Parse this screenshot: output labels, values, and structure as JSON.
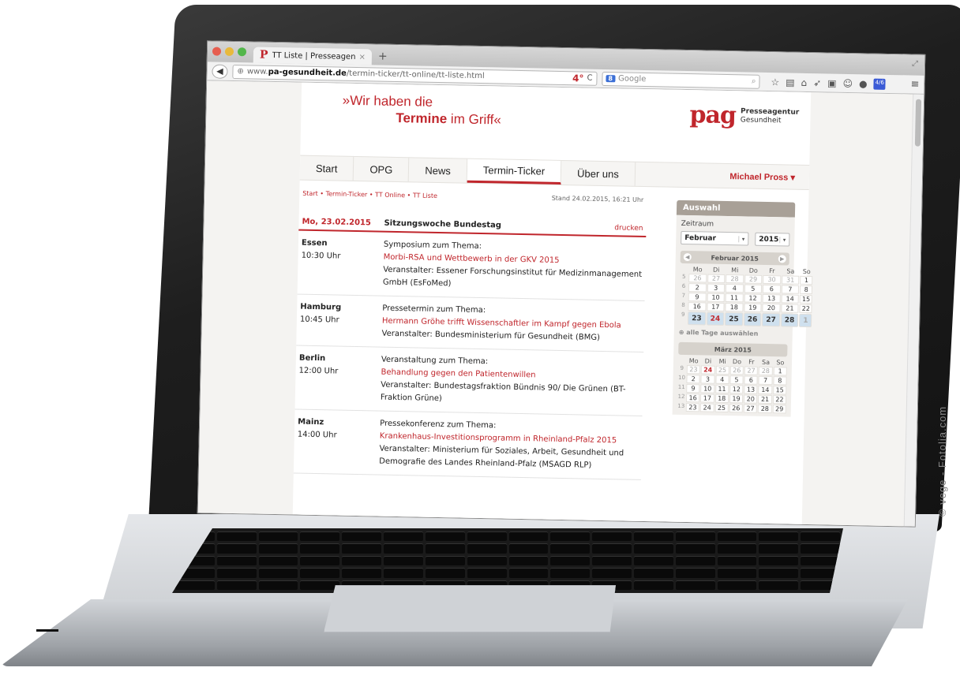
{
  "browser": {
    "tab_title": "TT Liste | Presseagentur G...",
    "tab_close": "×",
    "new_tab": "+",
    "url_prefix": "www.",
    "url_host": "pa-gesundheit.de",
    "url_path": "/termin-ticker/tt-online/tt-liste.html",
    "url_badge": "4°",
    "reload": "C",
    "search_engine": "8",
    "search_placeholder": "Google"
  },
  "header": {
    "slogan_line1": "»Wir haben die",
    "slogan_bold": "Termine",
    "slogan_line2_rest": " im Griff«",
    "logo_mark": "pag",
    "logo_line1": "Presseagentur",
    "logo_line2": "Gesundheit"
  },
  "nav": {
    "items": [
      "Start",
      "OPG",
      "News",
      "Termin-Ticker",
      "Über uns"
    ],
    "active_index": 3,
    "user": "Michael Pross ▾"
  },
  "content": {
    "breadcrumb": "Start • Termin-Ticker • TT Online • TT Liste",
    "stand": "Stand 24.02.2015, 16:21 Uhr",
    "day_date": "Mo, 23.02.2015",
    "day_session": "Sitzungswoche Bundestag",
    "print_label": "drucken",
    "events": [
      {
        "city": "Essen",
        "time": "10:30 Uhr",
        "kind": "Symposium zum Thema:",
        "title": "Morbi-RSA und Wettbewerb in der GKV 2015",
        "organizer": "Veranstalter: Essener Forschungsinstitut für Medizinmanagement GmbH (EsFoMed)"
      },
      {
        "city": "Hamburg",
        "time": "10:45 Uhr",
        "kind": "Pressetermin zum Thema:",
        "title": "Hermann Gröhe trifft Wissenschaftler im Kampf gegen Ebola",
        "organizer": "Veranstalter: Bundesministerium für Gesundheit (BMG)"
      },
      {
        "city": "Berlin",
        "time": "12:00 Uhr",
        "kind": "Veranstaltung zum Thema:",
        "title": "Behandlung gegen den Patientenwillen",
        "organizer": "Veranstalter: Bundestagsfraktion Bündnis 90/ Die Grünen (BT-Fraktion Grüne)"
      },
      {
        "city": "Mainz",
        "time": "14:00 Uhr",
        "kind": "Pressekonferenz zum Thema:",
        "title": "Krankenhaus-Investitionsprogramm in Rheinland-Pfalz 2015",
        "organizer": "Veranstalter: Ministerium für Soziales, Arbeit, Gesundheit und Demografie des Landes Rheinland-Pfalz (MSAGD RLP)"
      }
    ]
  },
  "sidebar": {
    "title": "Auswahl",
    "range_label": "Zeitraum",
    "month_value": "Februar",
    "year_value": "2015",
    "weekdays": [
      "Mo",
      "Di",
      "Mi",
      "Do",
      "Fr",
      "Sa",
      "So"
    ],
    "feb": {
      "title": "Februar 2015",
      "weeks": [
        {
          "wk": "5",
          "days": [
            "26",
            "27",
            "28",
            "29",
            "30",
            "31",
            "1"
          ]
        },
        {
          "wk": "6",
          "days": [
            "2",
            "3",
            "4",
            "5",
            "6",
            "7",
            "8"
          ]
        },
        {
          "wk": "7",
          "days": [
            "9",
            "10",
            "11",
            "12",
            "13",
            "14",
            "15"
          ]
        },
        {
          "wk": "8",
          "days": [
            "16",
            "17",
            "18",
            "19",
            "20",
            "21",
            "22"
          ]
        },
        {
          "wk": "9",
          "days": [
            "23",
            "24",
            "25",
            "26",
            "27",
            "28",
            "1"
          ]
        }
      ]
    },
    "all_days": "alle Tage auswählen",
    "mar": {
      "title": "März 2015",
      "weeks": [
        {
          "wk": "9",
          "days": [
            "23",
            "24",
            "25",
            "26",
            "27",
            "28",
            "1"
          ]
        },
        {
          "wk": "10",
          "days": [
            "2",
            "3",
            "4",
            "5",
            "6",
            "7",
            "8"
          ]
        },
        {
          "wk": "11",
          "days": [
            "9",
            "10",
            "11",
            "12",
            "13",
            "14",
            "15"
          ]
        },
        {
          "wk": "12",
          "days": [
            "16",
            "17",
            "18",
            "19",
            "20",
            "21",
            "22"
          ]
        },
        {
          "wk": "13",
          "days": [
            "23",
            "24",
            "25",
            "26",
            "27",
            "28",
            "29"
          ]
        }
      ]
    }
  },
  "watermark": "© vege - Fotolia.com",
  "colors": {
    "brand_red": "#c0262c",
    "sidebar_head": "#a8a097"
  }
}
